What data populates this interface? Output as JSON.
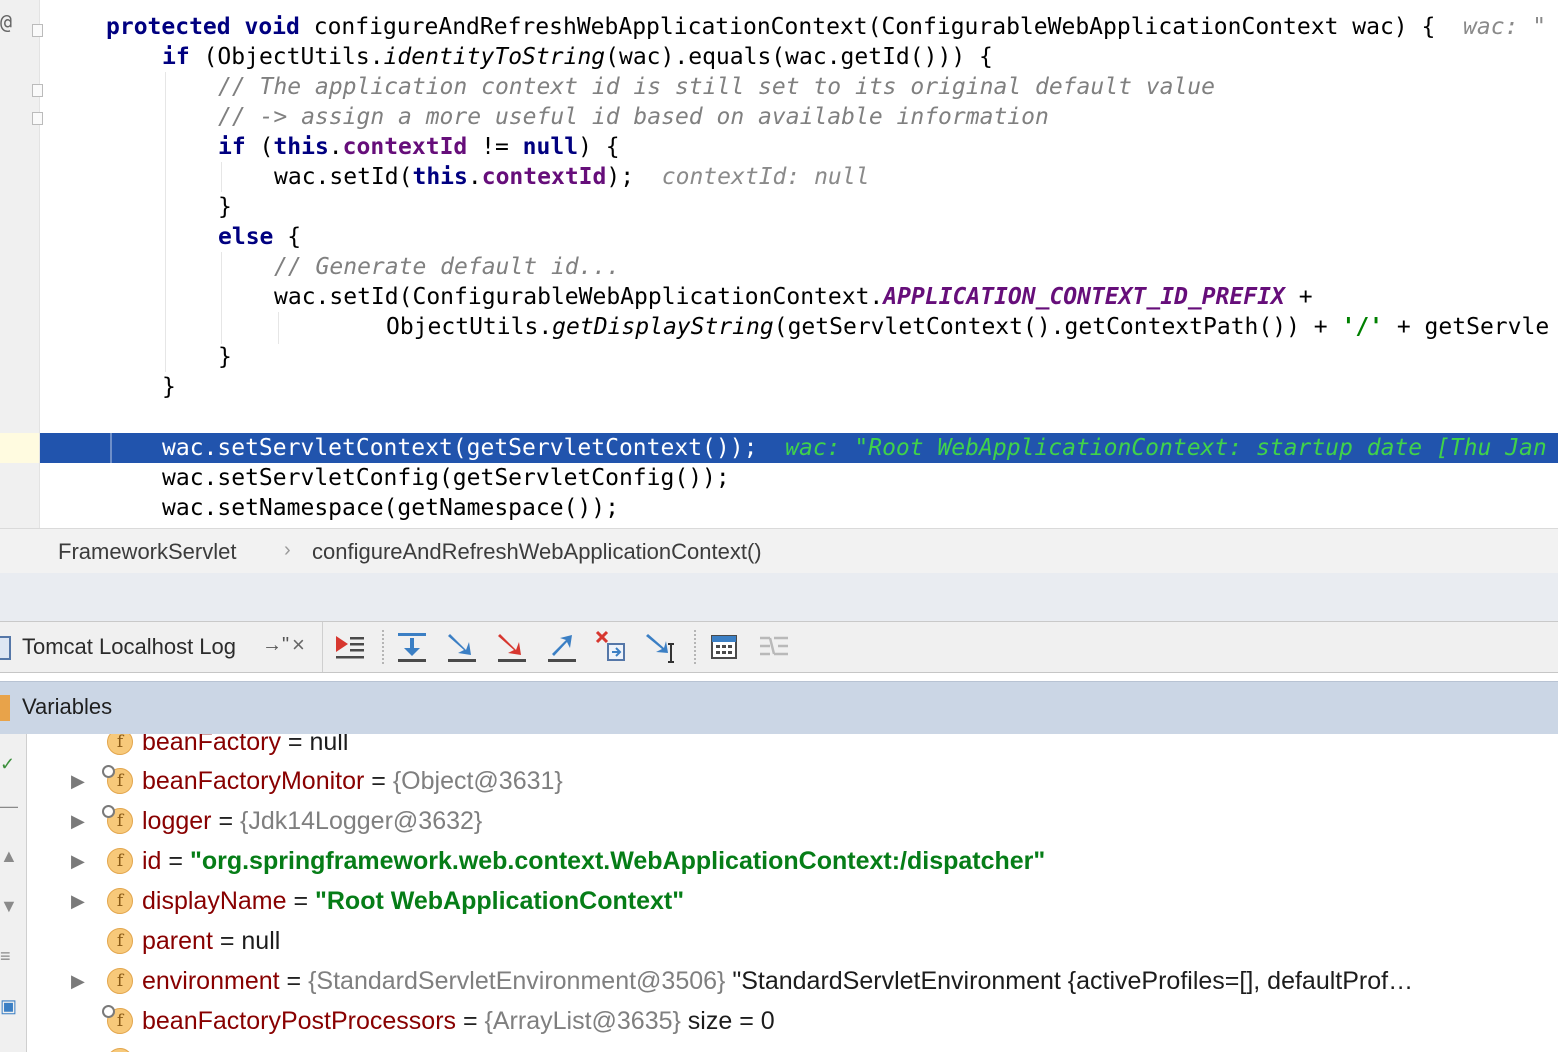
{
  "code": {
    "gutter_mark": "@",
    "l1": {
      "kw1": "protected",
      "kw2": "void",
      "text": " configureAndRefreshWebApplicationContext(ConfigurableWebApplicationContext wac) {",
      "hint": "wac: \""
    },
    "l2": {
      "kw": "if",
      "pre": " (ObjectUtils.",
      "static": "identityToString",
      "post": "(wac).equals(wac.getId())) {"
    },
    "l3": {
      "comment": "// The application context id is still set to its original default value"
    },
    "l4": {
      "comment": "// -> assign a more useful id based on available information"
    },
    "l5": {
      "kw1": "if",
      "pre": " (",
      "kw2": "this",
      "dot": ".",
      "field": "contextId",
      "mid": " != ",
      "kw3": "null",
      "post": ") {"
    },
    "l6": {
      "pre": "wac.setId(",
      "kw": "this",
      "dot": ".",
      "field": "contextId",
      "post": ");",
      "hint": "contextId: null"
    },
    "l7": {
      "text": "}"
    },
    "l8": {
      "kw": "else",
      "post": " {"
    },
    "l9": {
      "comment": "// Generate default id..."
    },
    "l10": {
      "pre": "wac.setId(ConfigurableWebApplicationContext.",
      "constant": "APPLICATION_CONTEXT_ID_PREFIX",
      "post": " +"
    },
    "l11": {
      "pre": "ObjectUtils.",
      "static": "getDisplayString",
      "mid": "(getServletContext().getContextPath()) + ",
      "str": "'/'",
      "post": " + getServle"
    },
    "l12": {
      "text": "}"
    },
    "l13": {
      "text": "}"
    },
    "exec": {
      "text": "wac.setServletContext(getServletContext());",
      "hint": "wac: \"Root WebApplicationContext: startup date [Thu Jan"
    },
    "l15": {
      "text": "wac.setServletConfig(getServletConfig());"
    },
    "l16": {
      "text": "wac.setNamespace(getNamespace());"
    }
  },
  "breadcrumb": {
    "items": [
      "FrameworkServlet",
      "configureAndRefreshWebApplicationContext()"
    ],
    "separator": "›"
  },
  "debug": {
    "tab_label": "Tomcat Localhost Log",
    "tab_pin": "→\"",
    "tab_close": "×",
    "tools": [
      {
        "name": "show-execution-point-icon"
      },
      {
        "name": "step-over-icon"
      },
      {
        "name": "step-into-icon"
      },
      {
        "name": "force-step-into-icon"
      },
      {
        "name": "step-out-icon"
      },
      {
        "name": "drop-frame-icon"
      },
      {
        "name": "run-to-cursor-icon"
      },
      {
        "name": "evaluate-expression-icon"
      },
      {
        "name": "trace-current-stream-icon"
      }
    ]
  },
  "variables": {
    "title": "Variables",
    "rows": [
      {
        "name": "beanFactory",
        "eq": " = ",
        "value": "null",
        "vtype": "plain",
        "expand": false,
        "locked": false
      },
      {
        "name": "beanFactoryMonitor",
        "eq": " = ",
        "value": "{Object@3631}",
        "vtype": "ref",
        "expand": true,
        "locked": true
      },
      {
        "name": "logger",
        "eq": " = ",
        "value": "{Jdk14Logger@3632}",
        "vtype": "ref",
        "expand": true,
        "locked": true
      },
      {
        "name": "id",
        "eq": " = ",
        "value": "\"org.springframework.web.context.WebApplicationContext:/dispatcher\"",
        "vtype": "str",
        "expand": true,
        "locked": false
      },
      {
        "name": "displayName",
        "eq": " = ",
        "value": "\"Root WebApplicationContext\"",
        "vtype": "str",
        "expand": true,
        "locked": false
      },
      {
        "name": "parent",
        "eq": " = ",
        "value": "null",
        "vtype": "plain",
        "expand": false,
        "locked": false
      },
      {
        "name": "environment",
        "eq": " = ",
        "value": "{StandardServletEnvironment@3506}",
        "extra": " \"StandardServletEnvironment {activeProfiles=[], defaultProf…",
        "vtype": "ref",
        "expand": true,
        "locked": false
      },
      {
        "name": "beanFactoryPostProcessors",
        "eq": " = ",
        "value": "{ArrayList@3635}",
        "extra": "  size = 0",
        "vtype": "ref",
        "expand": false,
        "locked": true
      }
    ],
    "expand_glyph": "▶",
    "field_glyph": "f"
  },
  "colors": {
    "exec_line": "#2154ad",
    "exec_hint": "#40d24a",
    "keyword": "#000080",
    "field": "#660e7a",
    "var_name": "#880000",
    "string": "#067d17"
  }
}
